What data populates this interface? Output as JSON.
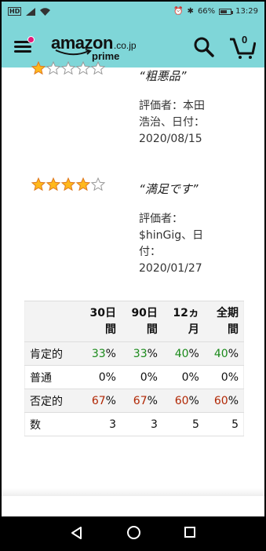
{
  "status_bar": {
    "left_badge": "HD",
    "battery": "66%",
    "battery_level": 0.66,
    "time": "13:29"
  },
  "header": {
    "logo_word": "amazon",
    "logo_domain": ".co.jp",
    "logo_sub": "prime",
    "cart_count": "0",
    "brand_color": "#7fd6d8",
    "notification_color": "#e4197a"
  },
  "reviews": [
    {
      "rating": 1,
      "title": "“粗悪品”",
      "meta_lines": [
        "評価者：本田",
        "浩治、日付：",
        "2020/08/15"
      ]
    },
    {
      "rating": 4,
      "title": "“満足です”",
      "meta_lines": [
        "評価者：",
        "$hinGig、日",
        "付：",
        "2020/01/27"
      ]
    }
  ],
  "stats_table": {
    "headers": [
      {
        "l1": "30日",
        "l2": "間"
      },
      {
        "l1": "90日",
        "l2": "間"
      },
      {
        "l1": "12ヵ",
        "l2": "月"
      },
      {
        "l1": "全期",
        "l2": "間"
      }
    ],
    "rows": [
      {
        "label": "肯定的",
        "kind": "pos",
        "cells": [
          {
            "num": "33",
            "unit": "%"
          },
          {
            "num": "33",
            "unit": "%"
          },
          {
            "num": "40",
            "unit": "%"
          },
          {
            "num": "40",
            "unit": "%"
          }
        ]
      },
      {
        "label": "普通",
        "kind": "neutral",
        "cells": [
          {
            "num": "0",
            "unit": "%"
          },
          {
            "num": "0",
            "unit": "%"
          },
          {
            "num": "0",
            "unit": "%"
          },
          {
            "num": "0",
            "unit": "%"
          }
        ]
      },
      {
        "label": "否定的",
        "kind": "neg",
        "cells": [
          {
            "num": "67",
            "unit": "%"
          },
          {
            "num": "67",
            "unit": "%"
          },
          {
            "num": "60",
            "unit": "%"
          },
          {
            "num": "60",
            "unit": "%"
          }
        ]
      },
      {
        "label": "数",
        "kind": "neutral",
        "cells": [
          {
            "num": "3",
            "unit": ""
          },
          {
            "num": "3",
            "unit": ""
          },
          {
            "num": "5",
            "unit": ""
          },
          {
            "num": "5",
            "unit": ""
          }
        ]
      }
    ],
    "colors": {
      "positive": "#1a8a1a",
      "negative": "#b12704"
    }
  },
  "icons": [
    "menu-icon",
    "search-icon",
    "cart-icon",
    "star-icon",
    "nav-back-icon",
    "nav-home-icon",
    "nav-recent-icon"
  ]
}
